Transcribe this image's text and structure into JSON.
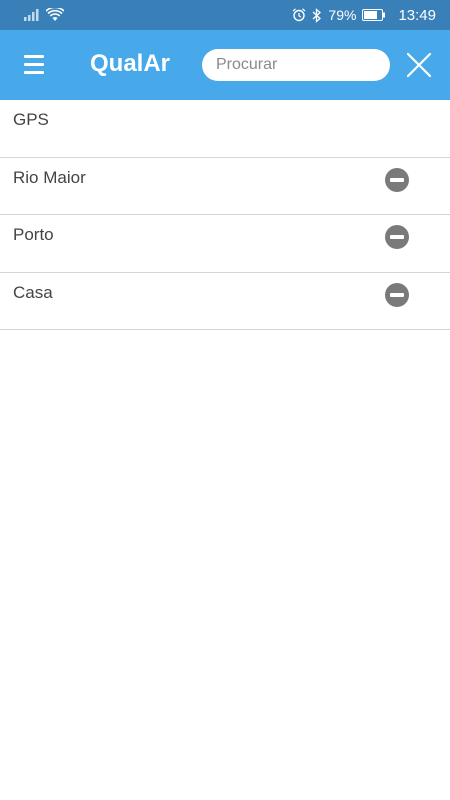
{
  "status_bar": {
    "battery": "79%",
    "time": "13:49",
    "icons": [
      "signal-icon",
      "wifi-icon",
      "alarm-icon",
      "bluetooth-icon",
      "battery-icon"
    ]
  },
  "app_bar": {
    "menu_icon": "hamburger-menu-icon",
    "title": "QualAr",
    "search_placeholder": "Procurar",
    "search_value": "",
    "close_icon": "close-icon",
    "color": "#47a9ea"
  },
  "locations": [
    {
      "label": "GPS",
      "removable": false
    },
    {
      "label": "Rio Maior",
      "removable": true
    },
    {
      "label": "Porto",
      "removable": true
    },
    {
      "label": "Casa",
      "removable": true
    }
  ],
  "remove_icon": "remove-circle-icon"
}
